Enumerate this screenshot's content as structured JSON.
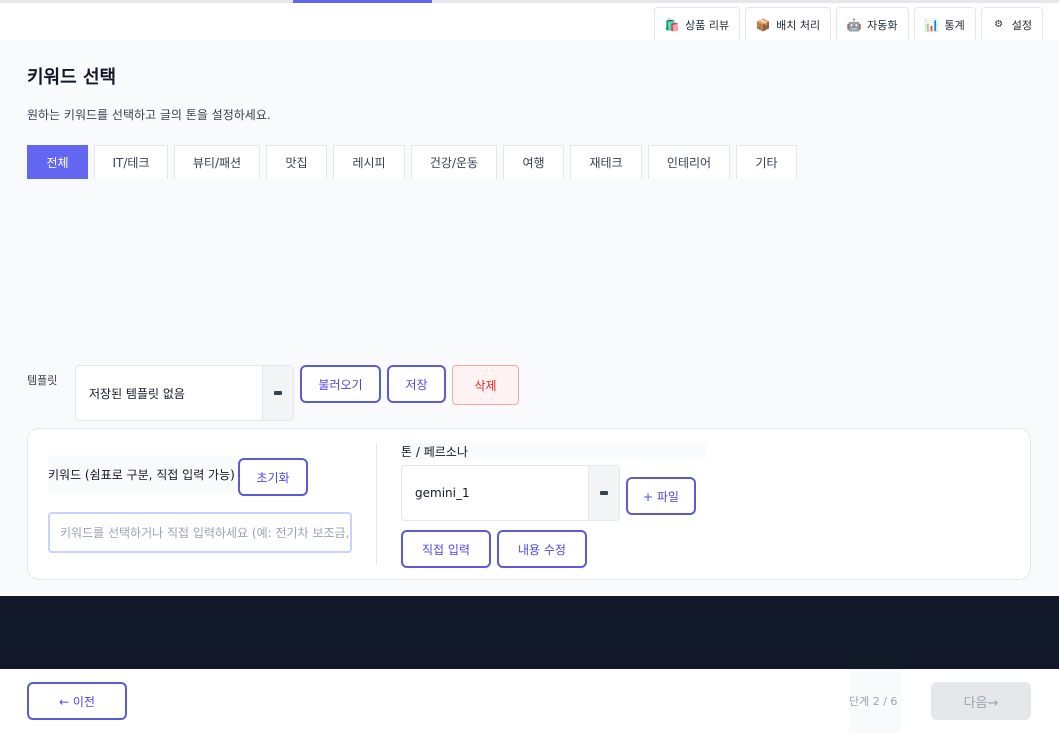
{
  "top_tabs": [
    {
      "icon": "shopping-bags-icon",
      "glyph": "🛍️",
      "label": "상품 리뷰"
    },
    {
      "icon": "package-icon",
      "glyph": "📦",
      "label": "배치 처리"
    },
    {
      "icon": "robot-icon",
      "glyph": "🤖",
      "label": "자동화"
    },
    {
      "icon": "bar-chart-icon",
      "glyph": "📊",
      "label": "통계"
    },
    {
      "icon": "gear-icon",
      "glyph": "⚙",
      "label": "설정"
    }
  ],
  "page": {
    "title": "키워드 선택",
    "subtitle": "원하는 키워드를 선택하고 글의 톤을 설정하세요."
  },
  "categories": [
    "전체",
    "IT/테크",
    "뷰티/패션",
    "맛집",
    "레시피",
    "건강/운동",
    "여행",
    "재테크",
    "인테리어",
    "기타"
  ],
  "template": {
    "label": "템플릿",
    "selected": "저장된 템플릿 없음",
    "load_label": "불러오기",
    "save_label": "저장",
    "delete_label": "삭제"
  },
  "keywords": {
    "label": "키워드 (쉼표로 구분, 직접 입력 가능)",
    "reset_label": "초기화",
    "placeholder": "키워드를 선택하거나 직접 입력하세요 (예: 전기차 보조금, 제주도 여행)"
  },
  "tone": {
    "label": "톤 / 페르소나",
    "selected": "gemini_1",
    "file_label": "+ 파일",
    "direct_input_label": "직접 입력",
    "edit_content_label": "내용 수정"
  },
  "footer": {
    "prev_label": "← 이전",
    "step_text": "단계  2 / 6",
    "next_label": "다음→"
  },
  "colors": {
    "accent": "#6366f1",
    "danger": "#dc2626",
    "dark_band": "#111827"
  }
}
